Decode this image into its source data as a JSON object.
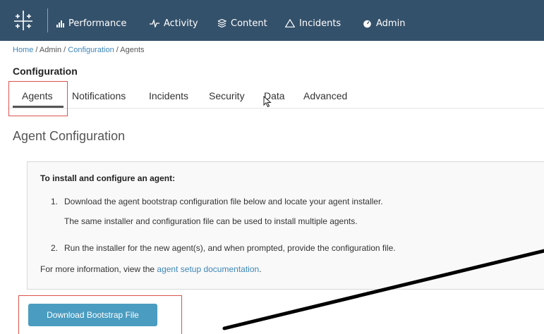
{
  "nav": {
    "items": [
      {
        "label": "Performance",
        "icon": "bar-chart-icon"
      },
      {
        "label": "Activity",
        "icon": "pulse-icon"
      },
      {
        "label": "Content",
        "icon": "layers-icon"
      },
      {
        "label": "Incidents",
        "icon": "warning-triangle-icon"
      },
      {
        "label": "Admin",
        "icon": "admin-gauge-icon"
      }
    ]
  },
  "breadcrumb": {
    "home": "Home",
    "sep1": " / ",
    "admin": "Admin",
    "sep2": " / ",
    "configuration": "Configuration",
    "sep3": " / ",
    "current": "Agents"
  },
  "page_title": "Configuration",
  "tabs": [
    {
      "label": "Agents",
      "active": true
    },
    {
      "label": "Notifications"
    },
    {
      "label": "Incidents"
    },
    {
      "label": "Security"
    },
    {
      "label": "Data"
    },
    {
      "label": "Advanced"
    }
  ],
  "section_title": "Agent Configuration",
  "instructions": {
    "heading": "To install and configure an agent:",
    "step1_number": "1.",
    "step1_line1": "Download the agent bootstrap configuration file below and locate your agent installer.",
    "step1_line2": "The same installer and configuration file can be used to install multiple agents.",
    "step2_number": "2.",
    "step2_line1": "Run the installer for the new agent(s), and when prompted, provide the configuration file.",
    "more_info_prefix": "For more information, view the ",
    "more_info_link": "agent setup documentation",
    "more_info_suffix": "."
  },
  "download_button": "Download Bootstrap File",
  "colors": {
    "topbar": "#34516b",
    "link": "#3d86b8",
    "button": "#4a9cc0",
    "highlight": "#d9534f"
  }
}
